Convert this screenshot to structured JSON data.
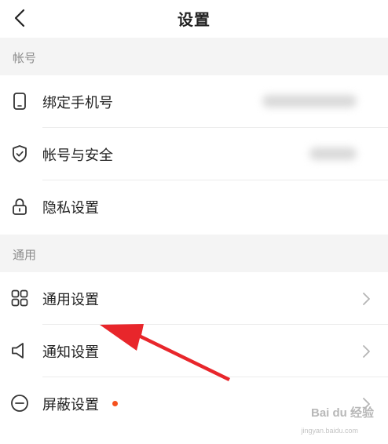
{
  "header": {
    "title": "设置",
    "back_icon": "chevron-left-icon"
  },
  "sections": {
    "account": {
      "title": "帐号",
      "items": [
        {
          "label": "绑定手机号",
          "icon": "phone-icon",
          "value": "(blurred)"
        },
        {
          "label": "帐号与安全",
          "icon": "shield-check-icon",
          "value": "(blurred)"
        },
        {
          "label": "隐私设置",
          "icon": "lock-icon"
        }
      ]
    },
    "general": {
      "title": "通用",
      "items": [
        {
          "label": "通用设置",
          "icon": "grid-icon"
        },
        {
          "label": "通知设置",
          "icon": "speaker-icon"
        },
        {
          "label": "屏蔽设置",
          "icon": "minus-circle-icon",
          "badge": "red-dot"
        }
      ]
    }
  },
  "annotation": {
    "arrow_color": "#e8262b"
  },
  "watermark": {
    "logo": "Bai du 经验",
    "url": "jingyan.baidu.com"
  },
  "colors": {
    "section_bg": "#f4f4f4",
    "text": "#222222",
    "subtle_text": "#8c8c8c",
    "badge": "#f5511e"
  }
}
